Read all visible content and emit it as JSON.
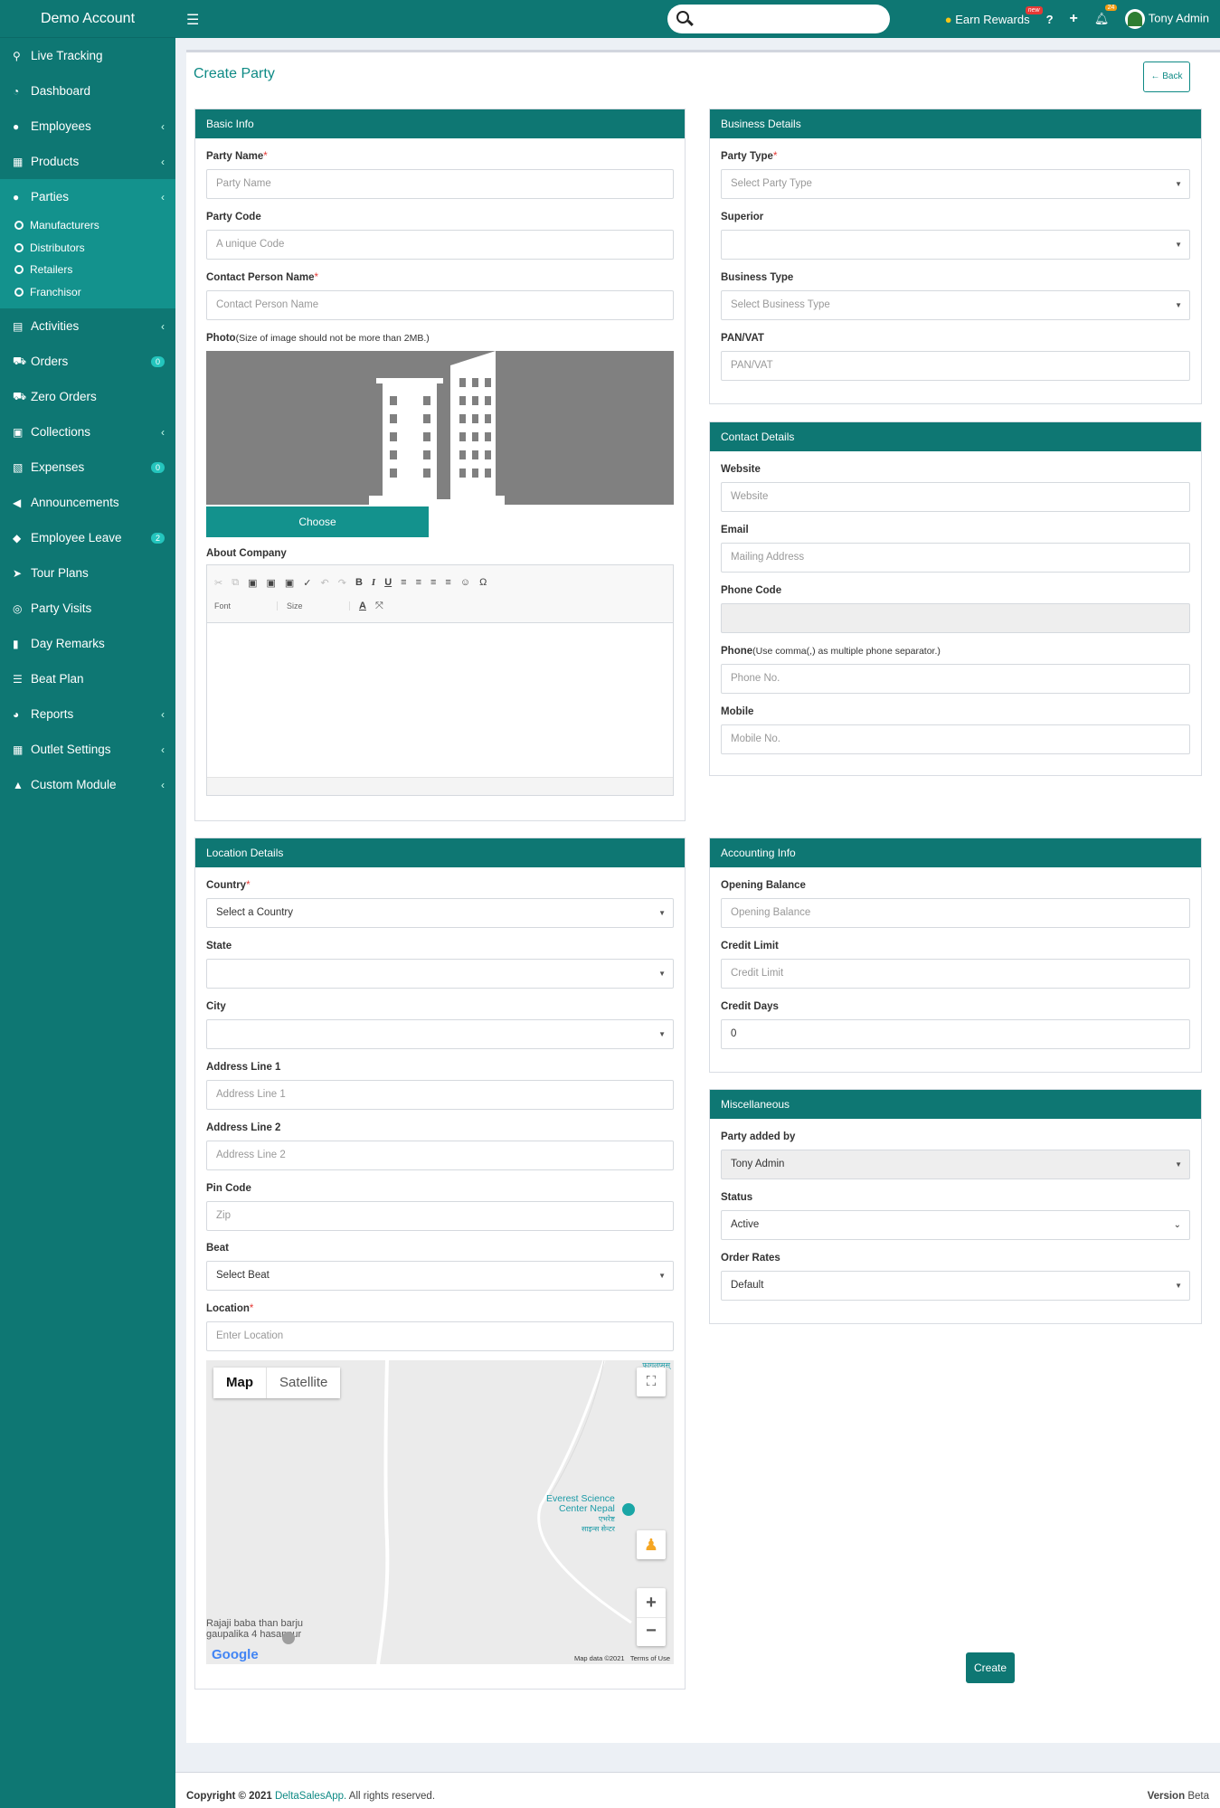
{
  "brand": "Demo Account",
  "topbar": {
    "earn_rewards": "Earn Rewards",
    "new_tag": "new",
    "help": "?",
    "add": "+",
    "notif_count": "24",
    "user": "Tony Admin"
  },
  "sidebar": {
    "items": [
      {
        "label": "Live Tracking",
        "icon": "map-pin-icon"
      },
      {
        "label": "Dashboard",
        "icon": "dashboard-icon"
      },
      {
        "label": "Employees",
        "icon": "user-icon",
        "chevron": "‹"
      },
      {
        "label": "Products",
        "icon": "grid-icon",
        "chevron": "‹"
      },
      {
        "label": "Parties",
        "icon": "user-icon",
        "chevron": "‹"
      },
      {
        "label": "Activities",
        "icon": "file-icon",
        "chevron": "‹"
      },
      {
        "label": "Orders",
        "icon": "cart-icon",
        "badge": "0"
      },
      {
        "label": "Zero Orders",
        "icon": "cart-icon"
      },
      {
        "label": "Collections",
        "icon": "money-icon",
        "chevron": "‹"
      },
      {
        "label": "Expenses",
        "icon": "expense-icon",
        "badge": "0"
      },
      {
        "label": "Announcements",
        "icon": "megaphone-icon"
      },
      {
        "label": "Employee Leave",
        "icon": "tag-icon",
        "badge": "2"
      },
      {
        "label": "Tour Plans",
        "icon": "plane-icon"
      },
      {
        "label": "Party Visits",
        "icon": "handshake-icon"
      },
      {
        "label": "Day Remarks",
        "icon": "book-icon"
      },
      {
        "label": "Beat Plan",
        "icon": "list-icon"
      },
      {
        "label": "Reports",
        "icon": "pie-icon",
        "chevron": "‹"
      },
      {
        "label": "Outlet Settings",
        "icon": "grid-icon",
        "chevron": "‹"
      },
      {
        "label": "Custom Module",
        "icon": "lock-icon",
        "chevron": "‹"
      }
    ],
    "sub_items": [
      "Manufacturers",
      "Distributors",
      "Retailers",
      "Franchisor"
    ]
  },
  "page": {
    "title": "Create Party",
    "back": "Back",
    "create": "Create"
  },
  "basic_info": {
    "heading": "Basic Info",
    "party_name_label": "Party Name",
    "party_name_ph": "Party Name",
    "party_code_label": "Party Code",
    "party_code_ph": "A unique Code",
    "contact_label": "Contact Person Name",
    "contact_ph": "Contact Person Name",
    "photo_label": "Photo",
    "photo_hint": "(Size of image should not be more than 2MB.)",
    "choose": "Choose",
    "about_label": "About Company",
    "font_sel": "Font",
    "size_sel": "Size"
  },
  "business": {
    "heading": "Business Details",
    "party_type_label": "Party Type",
    "party_type_val": "Select Party Type",
    "superior_label": "Superior",
    "superior_val": "",
    "business_type_label": "Business Type",
    "business_type_val": "Select Business Type",
    "pan_label": "PAN/VAT",
    "pan_ph": "PAN/VAT"
  },
  "contact": {
    "heading": "Contact Details",
    "website_label": "Website",
    "website_ph": "Website",
    "email_label": "Email",
    "email_ph": "Mailing Address",
    "phone_code_label": "Phone Code",
    "phone_label": "Phone",
    "phone_hint": "(Use comma(,) as multiple phone separator.)",
    "phone_ph": "Phone No.",
    "mobile_label": "Mobile",
    "mobile_ph": "Mobile No."
  },
  "location": {
    "heading": "Location Details",
    "country_label": "Country",
    "country_val": "Select a Country",
    "state_label": "State",
    "city_label": "City",
    "addr1_label": "Address Line 1",
    "addr1_ph": "Address Line 1",
    "addr2_label": "Address Line 2",
    "addr2_ph": "Address Line 2",
    "pin_label": "Pin Code",
    "pin_ph": "Zip",
    "beat_label": "Beat",
    "beat_val": "Select Beat",
    "location_label": "Location",
    "location_ph": "Enter Location",
    "map_tab": "Map",
    "satellite_tab": "Satellite",
    "poi_line1": "Everest Science",
    "poi_line2": "Center Nepal",
    "poi_local1": "एभरेष्ट",
    "poi_local2": "साइन्स सेन्टर",
    "place_line1": "Rajaji baba than barju",
    "place_line2": "gaupalika 4 hasanpur",
    "google": "Google",
    "map_data": "Map data ©2021",
    "terms": "Terms of Use",
    "top_label": "फागलप्मस्"
  },
  "accounting": {
    "heading": "Accounting Info",
    "opening_label": "Opening Balance",
    "opening_ph": "Opening Balance",
    "credit_limit_label": "Credit Limit",
    "credit_limit_ph": "Credit Limit",
    "credit_days_label": "Credit Days",
    "credit_days_val": "0"
  },
  "misc": {
    "heading": "Miscellaneous",
    "added_by_label": "Party added by",
    "added_by_val": "Tony Admin",
    "status_label": "Status",
    "status_val": "Active",
    "order_rates_label": "Order Rates",
    "order_rates_val": "Default"
  },
  "footer": {
    "copyright": "Copyright © 2021",
    "brand": "DeltaSalesApp.",
    "rights": "All rights reserved.",
    "version_label": "Version",
    "version_val": "Beta"
  }
}
